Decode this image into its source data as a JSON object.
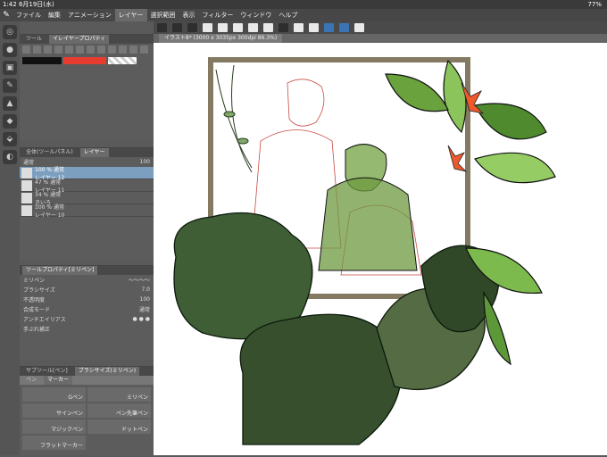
{
  "status_bar": {
    "time_date": "1:42  6月19日(水)",
    "battery": "77%"
  },
  "menu": {
    "app_icon": "brush-icon",
    "items": [
      "ファイル",
      "編集",
      "アニメーション",
      "レイヤー",
      "選択範囲",
      "表示",
      "フィルター",
      "ウィンドウ",
      "ヘルプ"
    ],
    "active_index": 3
  },
  "document_tab": {
    "title": "イラスト8* (3000 x 3035px 300dpi 86.3%)"
  },
  "tool_panel": {
    "tabs": [
      "ツール",
      "イレイヤープロパティ"
    ]
  },
  "colors": {
    "main": "#111111",
    "sub": "#e63b2e"
  },
  "layer_panel": {
    "tabs": [
      "全体(ツールパネル)",
      "レイヤー"
    ],
    "blend_mode": "通常",
    "opacity": "100",
    "layers": [
      {
        "opacity": "100 % 通常",
        "name": "レイヤー 12"
      },
      {
        "opacity": "47 % 通常",
        "name": "レイヤー 11"
      },
      {
        "opacity": "34 % 通常",
        "name": "きいろ"
      },
      {
        "opacity": "100 % 通常",
        "name": "レイヤー 10"
      }
    ],
    "selected_index": 0
  },
  "tool_property": {
    "title": "ツールプロパティ[ミリペン]",
    "brush_name": "ミリペン",
    "brush_size_label": "ブラシサイズ",
    "brush_size_value": "7.0",
    "opacity_label": "不透明度",
    "opacity_value": "100",
    "blend_label": "合成モード",
    "blend_value": "通常",
    "antialias_label": "アンチエイリアス",
    "stabilize_label": "手ぶれ補正"
  },
  "sub_tool": {
    "tabs": [
      "サブツール[ペン]",
      "ブラシサイズ(ミリペン)"
    ],
    "groups": [
      "ペン",
      "マーカー"
    ],
    "brushes": [
      "Gペン",
      "ミリペン",
      "サインペン",
      "ペン先筆ペン",
      "マジックペン",
      "ドットペン",
      "フラットマーカー"
    ]
  }
}
